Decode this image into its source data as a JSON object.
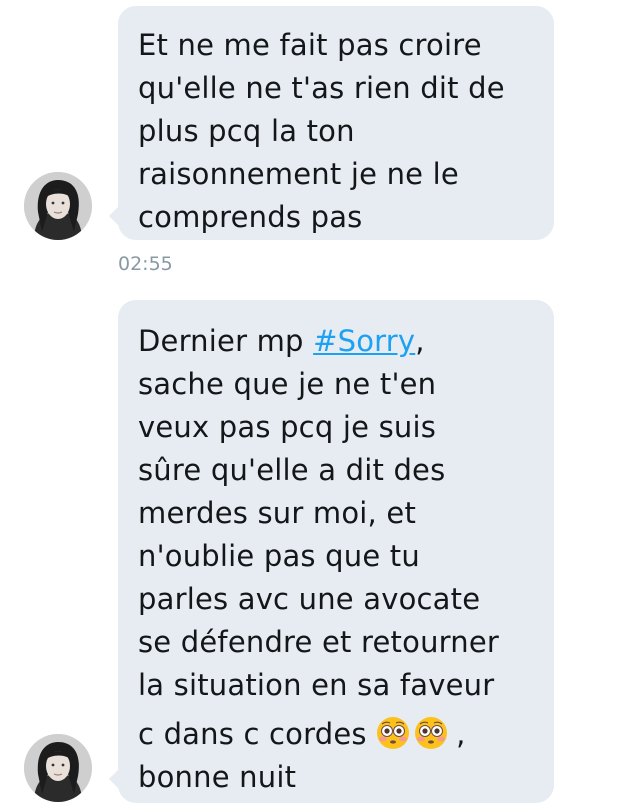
{
  "messages": [
    {
      "lines": [
        "Et ne me fait pas croire",
        "qu'elle ne t'as rien dit de",
        "plus pcq la ton",
        "raisonnement je ne le",
        "comprends pas"
      ],
      "timestamp": "02:55"
    },
    {
      "line1_before": "Dernier mp ",
      "hashtag": "#Sorry",
      "line1_after": ",",
      "lines": [
        "sache que je ne t'en",
        "veux pas pcq je suis",
        "sûre qu'elle a dit des",
        "merdes sur moi, et",
        "n'oublie pas que tu",
        "parles avc une avocate",
        "se défendre et retourner",
        "la situation en sa faveur"
      ],
      "last_line_text": "c dans c cordes ",
      "last_line_after_emoji": ",",
      "final_line": "bonne nuit",
      "emoji": [
        "flushed-face-emoji",
        "flushed-face-emoji"
      ]
    }
  ],
  "colors": {
    "bubble": "#e6ecf2",
    "text": "#14171a",
    "hashtag": "#1da1f2",
    "timestamp": "#8899a6"
  },
  "icons": {
    "avatar": "profile-photo-avatar"
  }
}
